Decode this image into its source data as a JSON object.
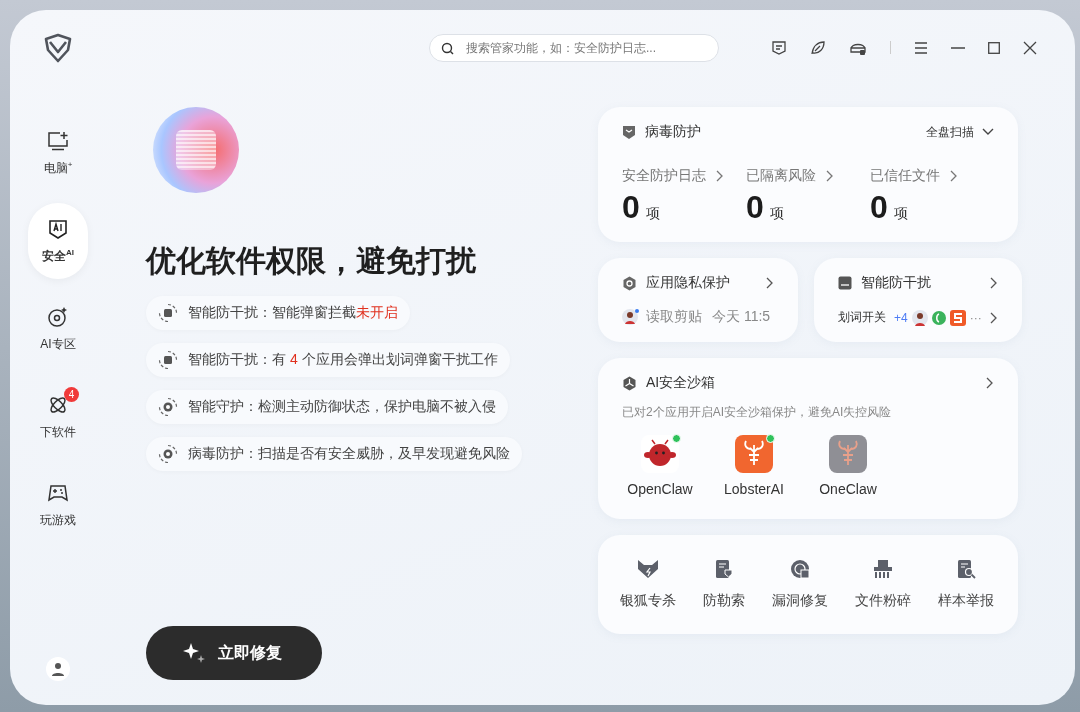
{
  "title_bar": {
    "search": {
      "placeholder": "搜索管家功能，如：安全防护日志..."
    }
  },
  "sidebar": {
    "items": [
      {
        "label": "电脑$^{+}$",
        "kind": "pc",
        "selected": false
      },
      {
        "label": "安全$^{AI}$",
        "kind": "ai-shield",
        "selected": true
      },
      {
        "label": "AI专区",
        "kind": "ai-zone",
        "selected": false
      },
      {
        "label": "下软件",
        "kind": "apps",
        "selected": false,
        "badge": "4"
      },
      {
        "label": "玩游戏",
        "kind": "game",
        "selected": false
      }
    ]
  },
  "hero": {
    "headline": "优化软件权限，避免打扰",
    "tips": [
      {
        "kind": "window",
        "parts": [
          {
            "text": "智能防干扰：智能弹窗拦截",
            "alert": false
          },
          {
            "text": "未开启",
            "alert": true
          }
        ]
      },
      {
        "kind": "window",
        "parts": [
          {
            "text": "智能防干扰：有 ",
            "alert": false
          },
          {
            "text": "4",
            "alert": true
          },
          {
            "text": " 个应用会弹出划词弹窗干扰工作",
            "alert": false
          }
        ]
      },
      {
        "kind": "target",
        "parts": [
          {
            "text": "智能守护：检测主动防御状态，保护电脑不被入侵",
            "alert": false
          }
        ]
      },
      {
        "kind": "target",
        "parts": [
          {
            "text": "病毒防护：扫描是否有安全威胁，及早发现避免风险",
            "alert": false
          }
        ]
      }
    ],
    "action": "立即修复"
  },
  "virus_card": {
    "title": "病毒防护",
    "scan": "全盘扫描",
    "stats": [
      {
        "label": "安全防护日志",
        "value": "0",
        "unit": "项"
      },
      {
        "label": "已隔离风险",
        "value": "0",
        "unit": "项"
      },
      {
        "label": "已信任文件",
        "value": "0",
        "unit": "项"
      }
    ]
  },
  "privacy_card": {
    "title": "应用隐私保护",
    "event": "读取剪贴",
    "time": "今天 11:5"
  },
  "anti_disturb_card": {
    "title": "智能防干扰",
    "label": "划词开关",
    "extra": "+4",
    "more": "···"
  },
  "sandbox_card": {
    "title": "AI安全沙箱",
    "description": "已对2个应用开启AI安全沙箱保护，避免AI失控风险",
    "apps": [
      {
        "name": "OpenClaw",
        "kind": "mascot",
        "running": true
      },
      {
        "name": "LobsterAI",
        "kind": "lobster",
        "running": true
      },
      {
        "name": "OneClaw",
        "kind": "lobster",
        "running": false
      }
    ]
  },
  "tools": [
    {
      "label": "银狐专杀",
      "kind": "fox"
    },
    {
      "label": "防勒索",
      "kind": "doc-shield"
    },
    {
      "label": "漏洞修复",
      "kind": "radar"
    },
    {
      "label": "文件粉碎",
      "kind": "shredder"
    },
    {
      "label": "样本举报",
      "kind": "doc-search"
    }
  ]
}
